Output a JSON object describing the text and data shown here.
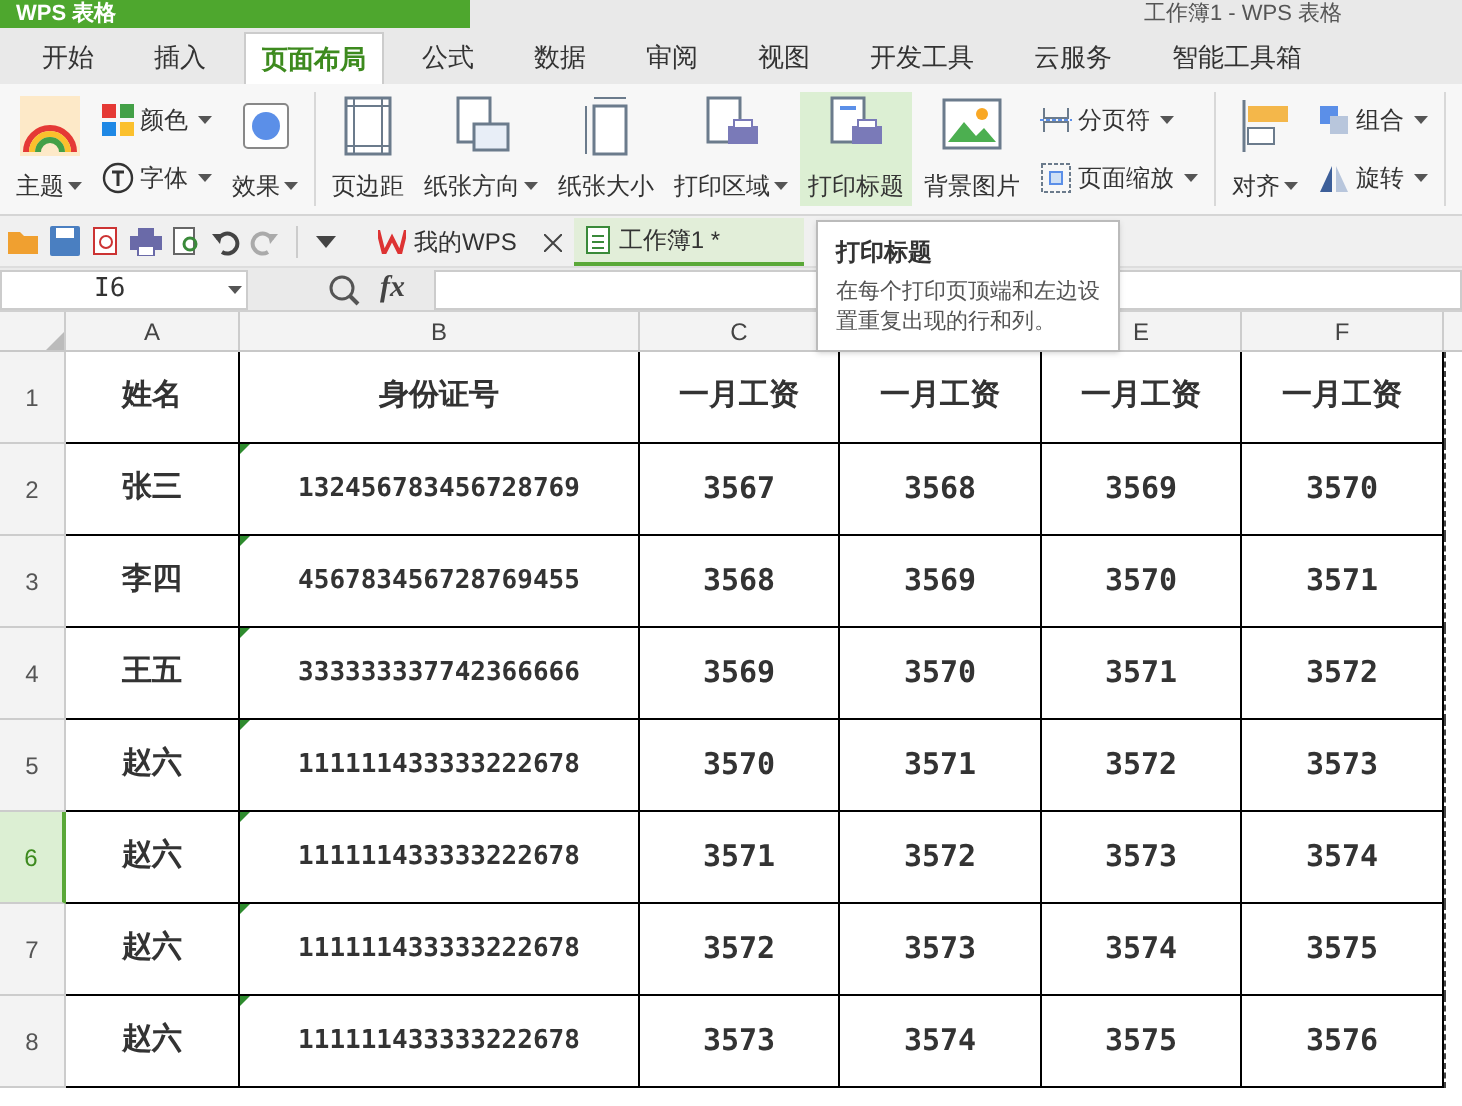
{
  "app_title": "WPS 表格",
  "window_title": "工作簿1 - WPS 表格",
  "tabs": [
    {
      "label": "开始",
      "selected": false
    },
    {
      "label": "插入",
      "selected": false
    },
    {
      "label": "页面布局",
      "selected": true
    },
    {
      "label": "公式",
      "selected": false
    },
    {
      "label": "数据",
      "selected": false
    },
    {
      "label": "审阅",
      "selected": false
    },
    {
      "label": "视图",
      "selected": false
    },
    {
      "label": "开发工具",
      "selected": false
    },
    {
      "label": "云服务",
      "selected": false
    },
    {
      "label": "智能工具箱",
      "selected": false
    }
  ],
  "ribbon_groups": [
    {
      "items": [
        {
          "kind": "large",
          "label": "主题",
          "dropdown": true,
          "highlighted": false
        },
        {
          "kind": "stack",
          "items": [
            {
              "label": "颜色",
              "dropdown": true
            },
            {
              "label": "字体",
              "dropdown": true
            }
          ]
        },
        {
          "kind": "large",
          "label": "效果",
          "dropdown": true,
          "highlighted": false
        }
      ]
    },
    {
      "items": [
        {
          "kind": "large",
          "label": "页边距",
          "dropdown": false,
          "highlighted": false
        },
        {
          "kind": "large",
          "label": "纸张方向",
          "dropdown": true,
          "highlighted": false
        },
        {
          "kind": "large",
          "label": "纸张大小",
          "dropdown": false,
          "highlighted": false
        },
        {
          "kind": "large",
          "label": "打印区域",
          "dropdown": true,
          "highlighted": false
        },
        {
          "kind": "large",
          "label": "打印标题",
          "dropdown": false,
          "highlighted": true
        },
        {
          "kind": "large",
          "label": "背景图片",
          "dropdown": false,
          "highlighted": false
        },
        {
          "kind": "stack",
          "items": [
            {
              "label": "分页符",
              "dropdown": true
            },
            {
              "label": "页面缩放",
              "dropdown": true
            }
          ]
        }
      ]
    },
    {
      "items": [
        {
          "kind": "large",
          "label": "对齐",
          "dropdown": true,
          "highlighted": false
        },
        {
          "kind": "stack",
          "items": [
            {
              "label": "组合",
              "dropdown": true
            },
            {
              "label": "旋转",
              "dropdown": true
            }
          ]
        }
      ]
    }
  ],
  "doc_tabs": [
    {
      "label": "我的WPS",
      "selected": false,
      "closable": true
    },
    {
      "label": "工作簿1 *",
      "selected": true,
      "closable": false
    }
  ],
  "name_box": "I6",
  "fx": "fx",
  "tooltip": {
    "title": "打印标题",
    "body": "在每个打印页顶端和左边设置重复出现的行和列。"
  },
  "columns": [
    {
      "letter": "A"
    },
    {
      "letter": "B"
    },
    {
      "letter": "C"
    },
    {},
    {
      "letter": "E"
    },
    {
      "letter": "F"
    }
  ],
  "rows": [
    {
      "number": "1",
      "selected": false,
      "marker": false,
      "cells": [
        "姓名",
        "身份证号",
        "一月工资",
        "一月工资",
        "一月工资",
        "一月工资"
      ]
    },
    {
      "number": "2",
      "selected": false,
      "marker": true,
      "cells": [
        "张三",
        "132456783456728769",
        "3567",
        "3568",
        "3569",
        "3570"
      ]
    },
    {
      "number": "3",
      "selected": false,
      "marker": true,
      "cells": [
        "李四",
        "456783456728769455",
        "3568",
        "3569",
        "3570",
        "3571"
      ]
    },
    {
      "number": "4",
      "selected": false,
      "marker": true,
      "cells": [
        "王五",
        "333333337742366666",
        "3569",
        "3570",
        "3571",
        "3572"
      ]
    },
    {
      "number": "5",
      "selected": false,
      "marker": true,
      "cells": [
        "赵六",
        "111111433333222678",
        "3570",
        "3571",
        "3572",
        "3573"
      ]
    },
    {
      "number": "6",
      "selected": true,
      "marker": true,
      "cells": [
        "赵六",
        "111111433333222678",
        "3571",
        "3572",
        "3573",
        "3574"
      ]
    },
    {
      "number": "7",
      "selected": false,
      "marker": true,
      "cells": [
        "赵六",
        "111111433333222678",
        "3572",
        "3573",
        "3574",
        "3575"
      ]
    },
    {
      "number": "8",
      "selected": false,
      "marker": true,
      "cells": [
        "赵六",
        "111111433333222678",
        "3573",
        "3574",
        "3575",
        "3576"
      ]
    }
  ]
}
